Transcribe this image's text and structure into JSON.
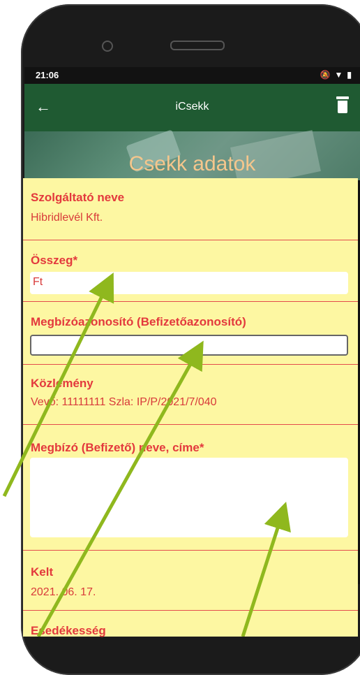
{
  "status_bar": {
    "time": "21:06",
    "icons": [
      "bell-off-icon",
      "wifi-icon",
      "battery-icon"
    ]
  },
  "app_bar": {
    "title": "iCsekk",
    "back_icon": "arrow-left-icon",
    "delete_icon": "trash-icon"
  },
  "header": {
    "title": "Csekk adatok"
  },
  "form": {
    "provider_label": "Szolgáltató neve",
    "provider_value": "Hibridlevél Kft.",
    "amount_label": "Összeg*",
    "amount_value": "Ft",
    "payer_id_label": "Megbízóazonosító (Befizetőazonosító)",
    "payer_id_value": "",
    "notice_label": "Közlemény",
    "notice_value": "Vevő: 11111111 Szla: IP/P/2021/7/040",
    "payer_name_label": "Megbízó (Befizető) neve, címe*",
    "payer_name_value": "",
    "date_label": "Kelt",
    "date_value": "2021. 06. 17.",
    "due_label": "Esedékesség"
  },
  "colors": {
    "app_bar": "#1f5a32",
    "panel": "#fdf7a2",
    "label": "#e3393d",
    "header_title": "#f5c68c",
    "arrow": "#8fb81e"
  }
}
